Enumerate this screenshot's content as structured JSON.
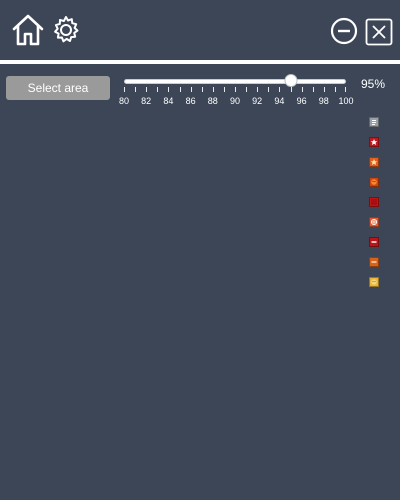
{
  "toolbar": {
    "home_icon": "home-icon",
    "settings_icon": "gear-icon",
    "minimize_icon": "minus-circle-icon",
    "close_icon": "close-box-icon"
  },
  "select_area": {
    "label": "Select area"
  },
  "threshold_slider": {
    "min": 80,
    "max": 100,
    "value": 95,
    "value_label": "95%",
    "tick_labels": [
      "80",
      "82",
      "84",
      "86",
      "88",
      "90",
      "92",
      "94",
      "96",
      "98",
      "100"
    ]
  },
  "legend_icons": [
    {
      "name": "list-icon",
      "color": "#9aa0a8"
    },
    {
      "name": "star-badge-icon",
      "color": "#c2181f"
    },
    {
      "name": "star-orange-icon",
      "color": "#e35e1d"
    },
    {
      "name": "warning-face-icon",
      "color": "#d04416"
    },
    {
      "name": "red-square-icon",
      "color": "#c41515"
    },
    {
      "name": "crosshair-icon",
      "color": "#e25b34"
    },
    {
      "name": "minus-badge-icon",
      "color": "#b8161a"
    },
    {
      "name": "dash-orange-icon",
      "color": "#d9621b"
    },
    {
      "name": "face-yellow-icon",
      "color": "#e8b73a"
    }
  ],
  "colors": {
    "background": "#3c4656",
    "accent_line": "#ffffff",
    "button_gray": "#9a9a9a"
  }
}
